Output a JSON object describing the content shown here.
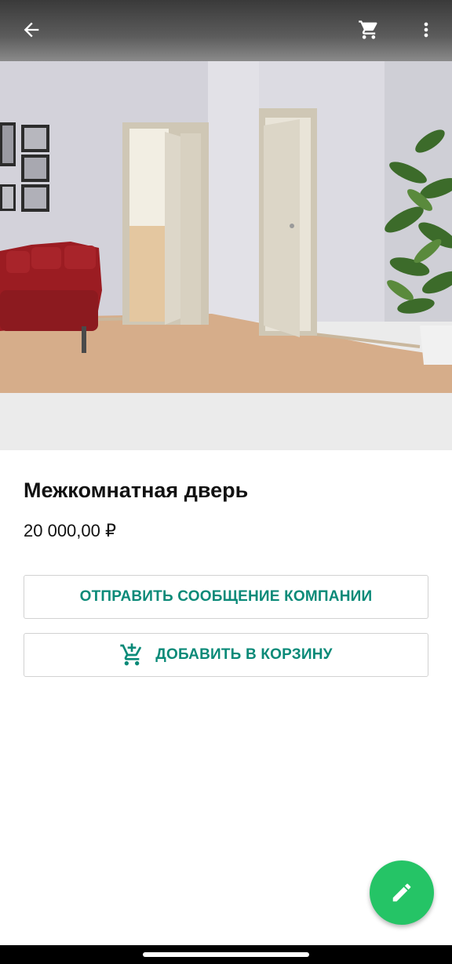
{
  "toolbar": {
    "back_icon": "arrow-back-icon",
    "cart_icon": "shopping-cart-icon",
    "more_icon": "more-vert-icon"
  },
  "product": {
    "image_alt": "interior-room-with-doors",
    "title": "Межкомнатная дверь",
    "price": "20 000,00 ₽"
  },
  "actions": {
    "message_label": "ОТПРАВИТЬ СООБЩЕНИЕ КОМПАНИИ",
    "add_to_cart_label": "ДОБАВИТЬ В КОРЗИНУ",
    "add_to_cart_icon": "add-shopping-cart-icon"
  },
  "fab": {
    "icon": "edit-pencil-icon"
  },
  "colors": {
    "accent": "#0a8a78",
    "fab": "#25c466",
    "text": "#111111",
    "border": "#d2d2d2"
  }
}
